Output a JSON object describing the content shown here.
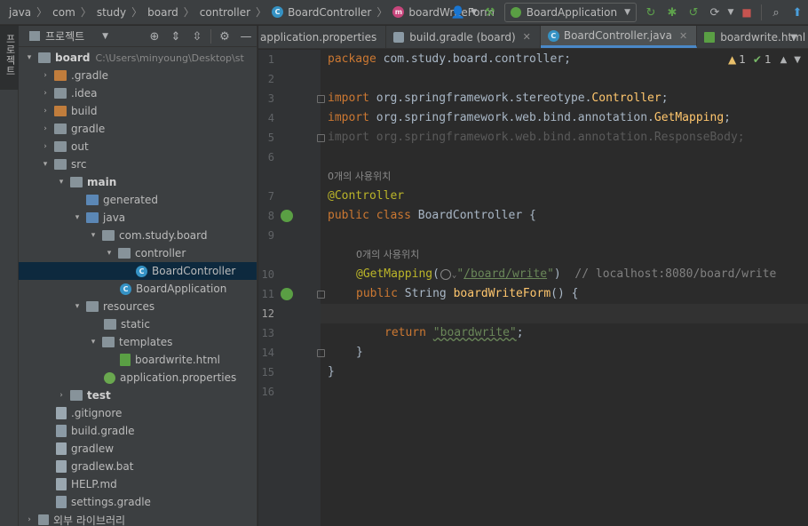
{
  "breadcrumb": [
    "java",
    "com",
    "study",
    "board",
    "controller",
    "BoardController",
    "boardWriteForm"
  ],
  "run_config": {
    "label": "BoardApplication"
  },
  "stripe": {
    "label": "프로젝트"
  },
  "project": {
    "title": "프로젝트",
    "tree": [
      {
        "label": "board",
        "path": "C:\\Users\\minyoung\\Desktop\\st"
      },
      {
        "label": ".gradle"
      },
      {
        "label": ".idea"
      },
      {
        "label": "build"
      },
      {
        "label": "gradle"
      },
      {
        "label": "out"
      },
      {
        "label": "src"
      },
      {
        "label": "main"
      },
      {
        "label": "generated"
      },
      {
        "label": "java"
      },
      {
        "label": "com.study.board"
      },
      {
        "label": "controller"
      },
      {
        "label": "BoardController"
      },
      {
        "label": "BoardApplication"
      },
      {
        "label": "resources"
      },
      {
        "label": "static"
      },
      {
        "label": "templates"
      },
      {
        "label": "boardwrite.html"
      },
      {
        "label": "application.properties"
      },
      {
        "label": "test"
      },
      {
        "label": ".gitignore"
      },
      {
        "label": "build.gradle"
      },
      {
        "label": "gradlew"
      },
      {
        "label": "gradlew.bat"
      },
      {
        "label": "HELP.md"
      },
      {
        "label": "settings.gradle"
      },
      {
        "label": "외부 라이브러리"
      }
    ]
  },
  "tabs": [
    {
      "label": "application.properties"
    },
    {
      "label": "build.gradle (board)"
    },
    {
      "label": "BoardController.java"
    },
    {
      "label": "boardwrite.html"
    }
  ],
  "inspections": {
    "warnings": "1",
    "ok": "1"
  },
  "editor": {
    "line_numbers": [
      "1",
      "2",
      "3",
      "4",
      "5",
      "6",
      "7",
      "8",
      "9",
      "10",
      "11",
      "12",
      "13",
      "14",
      "15",
      "16"
    ],
    "usage_hint": "0개의 사용위치",
    "code": {
      "l1_kw": "package",
      "l1_rest": " com.study.board.controller;",
      "l3_kw": "import",
      "l3_pkg": " org.springframework.stereotype.",
      "l3_cls": "Controller",
      "l3_end": ";",
      "l4_kw": "import",
      "l4_pkg": " org.springframework.web.bind.annotation.",
      "l4_cls": "GetMapping",
      "l4_end": ";",
      "l5": "import org.springframework.web.bind.annotation.ResponseBody;",
      "l7": "@Controller",
      "l8_kw": "public class",
      "l8_rest": " BoardController {",
      "l10_ann": "@GetMapping",
      "l10_open": "(",
      "l10_q1": "\"",
      "l10_url": "/board/write",
      "l10_q2": "\"",
      "l10_close": ")  ",
      "l10_cmt": "// localhost:8080/board/write",
      "l11_kw": "public",
      "l11_type": " String ",
      "l11_fn": "boardWriteForm",
      "l11_rest": "() {",
      "l13_kw": "return",
      "l13_sp": " ",
      "l13_str": "\"boardwrite\"",
      "l13_end": ";",
      "l14": "}",
      "l15": "}"
    }
  }
}
